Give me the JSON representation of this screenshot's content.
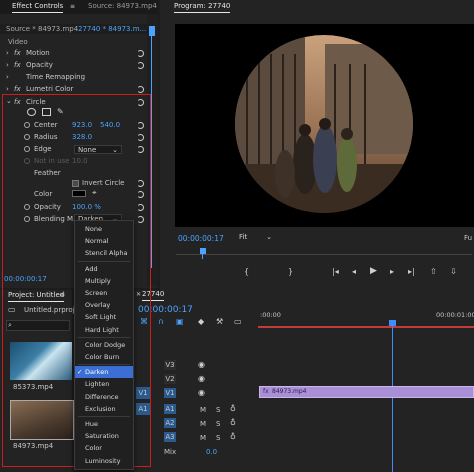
{
  "effect_controls": {
    "tab_title": "Effect Controls",
    "source_tab": "Source: 84973.mp4",
    "source_path": "Source * 84973.mp4",
    "seq_path": "27740 * 84973.m...",
    "section_video": "Video",
    "motion": "Motion",
    "opacity_fx": "Opacity",
    "time_remap": "Time Remapping",
    "lumetri": "Lumetri Color",
    "circle": "Circle",
    "center_label": "Center",
    "center_x": "923.0",
    "center_y": "540.0",
    "radius_label": "Radius",
    "radius_val": "328.0",
    "edge_label": "Edge",
    "edge_val": "None",
    "notinuse_label": "Not in use",
    "notinuse_val": "10.0",
    "feather_label": "Feather",
    "invert_label": "Invert Circle",
    "color_label": "Color",
    "opacity_label": "Opacity",
    "opacity_val": "100.0 %",
    "blend_label": "Blending M...",
    "blend_val": "Darken",
    "time": "00:00:00:17",
    "fx_glyph": "fx"
  },
  "blend_menu": {
    "groups": [
      [
        "None",
        "Normal",
        "Stencil Alpha"
      ],
      [
        "Add",
        "Multiply",
        "Screen",
        "Overlay",
        "Soft Light",
        "Hard Light"
      ],
      [
        "Color Dodge",
        "Color Burn"
      ],
      [
        "Darken",
        "Lighten",
        "Difference",
        "Exclusion"
      ],
      [
        "Hue",
        "Saturation",
        "Color",
        "Luminosity"
      ]
    ],
    "selected": "Darken",
    "check": "✓"
  },
  "program": {
    "title": "Program: 27740",
    "timecode": "00:00:00:17",
    "fit": "Fit",
    "right_clip": "Fu"
  },
  "project": {
    "title": "Project: Untitled",
    "file": "Untitled.prproj",
    "clip1": "85373.mp4",
    "clip2": "84973.mp4"
  },
  "timeline": {
    "tab": "27740",
    "timecode": "00:00:00:17",
    "ruler_start": ":00:00",
    "ruler_end": "00:00:01:00",
    "tracks_v": [
      "V3",
      "V2",
      "V1"
    ],
    "tracks_a": [
      "A1",
      "A2",
      "A3"
    ],
    "source_v": "V1",
    "source_a": "A1",
    "clip_label": "84973.mp4",
    "mix_label": "Mix",
    "mix_val": "0.0",
    "m_label": "M",
    "s_label": "S"
  },
  "colors": {
    "highlight_red": "#d01c1c",
    "accent_blue": "#4ba3ff",
    "clip_purple": "#a98fd6",
    "playhead": "#3f8cff",
    "menu_selected": "#3b6fd6"
  }
}
